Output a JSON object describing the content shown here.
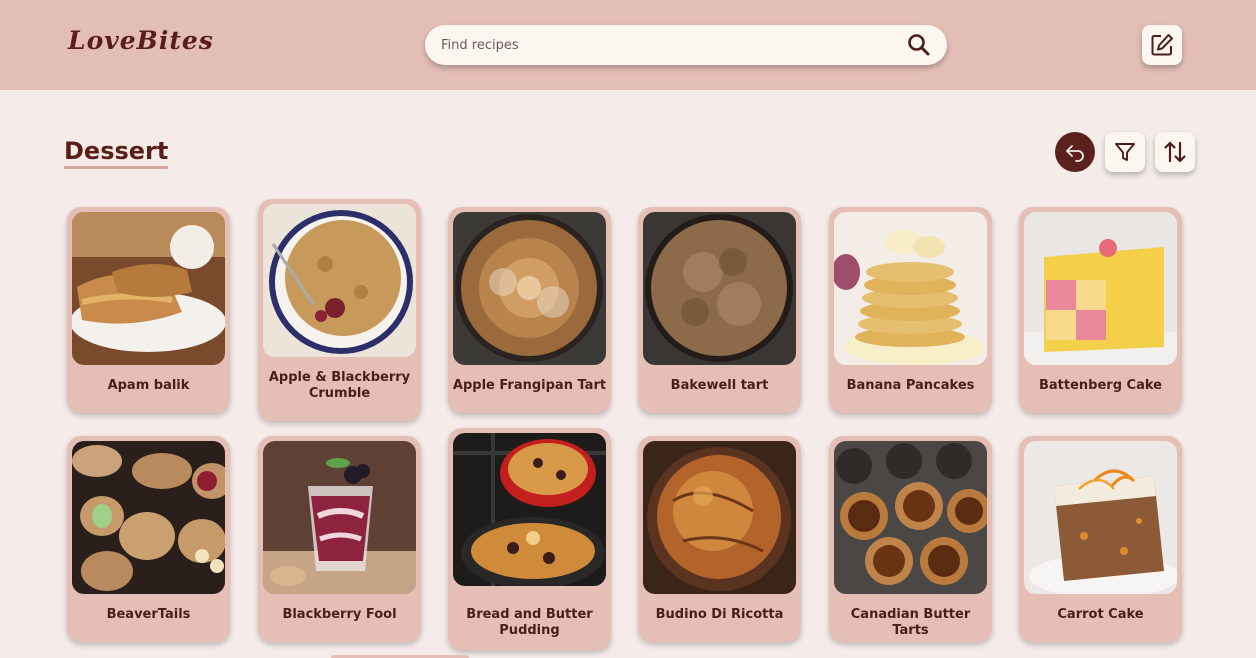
{
  "header": {
    "logo": "LoveBites",
    "search_placeholder": "Find recipes",
    "search_icon": "search-icon",
    "edit_icon": "edit-icon"
  },
  "page": {
    "title": "Dessert",
    "actions": [
      {
        "name": "back",
        "icon": "undo-arrow-icon"
      },
      {
        "name": "filter",
        "icon": "filter-icon"
      },
      {
        "name": "sort",
        "icon": "sort-arrows-icon"
      }
    ]
  },
  "recipes": [
    {
      "name": "Apam balik"
    },
    {
      "name": "Apple & Blackberry Crumble"
    },
    {
      "name": "Apple Frangipan Tart"
    },
    {
      "name": "Bakewell tart"
    },
    {
      "name": "Banana Pancakes"
    },
    {
      "name": "Battenberg Cake"
    },
    {
      "name": "BeaverTails"
    },
    {
      "name": "Blackberry Fool"
    },
    {
      "name": "Bread and Butter Pudding"
    },
    {
      "name": "Budino Di Ricotta"
    },
    {
      "name": "Canadian Butter Tarts"
    },
    {
      "name": "Carrot Cake"
    }
  ],
  "colors": {
    "header_bg": "#e3beb6",
    "page_bg": "#f5ecea",
    "card_bg": "#e5bfb6",
    "accent_dark": "#5b211c"
  }
}
